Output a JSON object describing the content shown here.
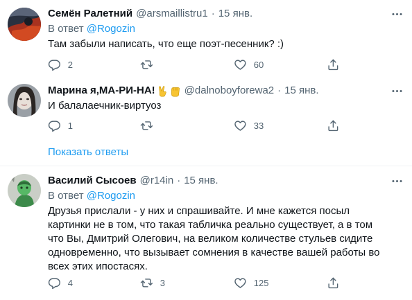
{
  "tweets": [
    {
      "name": "Семён Ралетний",
      "handle": "@arsmaillistru1",
      "separator": "·",
      "date": "15 янв.",
      "reply_prefix": "В ответ ",
      "reply_mention": "@Rogozin",
      "lines": [
        "Там забыли написать, что еще поэт-песенник? :)"
      ],
      "replies": "2",
      "retweets": "",
      "likes": "60"
    },
    {
      "name": "Марина я,МА-РИ-НА!",
      "emoji_icons": [
        "victory-hand-icon",
        "raised-fist-icon"
      ],
      "handle": "@dalnoboyforewa2",
      "separator": "·",
      "date": "15 янв.",
      "lines": [
        "И балалаечник-виртуоз"
      ],
      "replies": "1",
      "retweets": "",
      "likes": "33"
    },
    {
      "name": "Василий Сысоев",
      "handle": "@r14in",
      "separator": "·",
      "date": "15 янв.",
      "reply_prefix": "В ответ ",
      "reply_mention": "@Rogozin",
      "lines": [
        "Друзья прислали - у них и спрашивайте. И мне кажется посыл",
        "картинки не в том, что такая табличка реально существует, а в том",
        "что Вы, Дмитрий Олегович, на великом количестве стульев сидите",
        "одновременно, что вызывает сомнения в качестве вашей работы во",
        "всех этих ипостасях."
      ],
      "replies": "4",
      "retweets": "3",
      "likes": "125"
    }
  ],
  "show_replies_label": "Показать ответы",
  "colors": {
    "accent": "#1d9bf0",
    "secondary_text": "#536471",
    "primary_text": "#0f1419",
    "divider": "#eff3f4"
  }
}
